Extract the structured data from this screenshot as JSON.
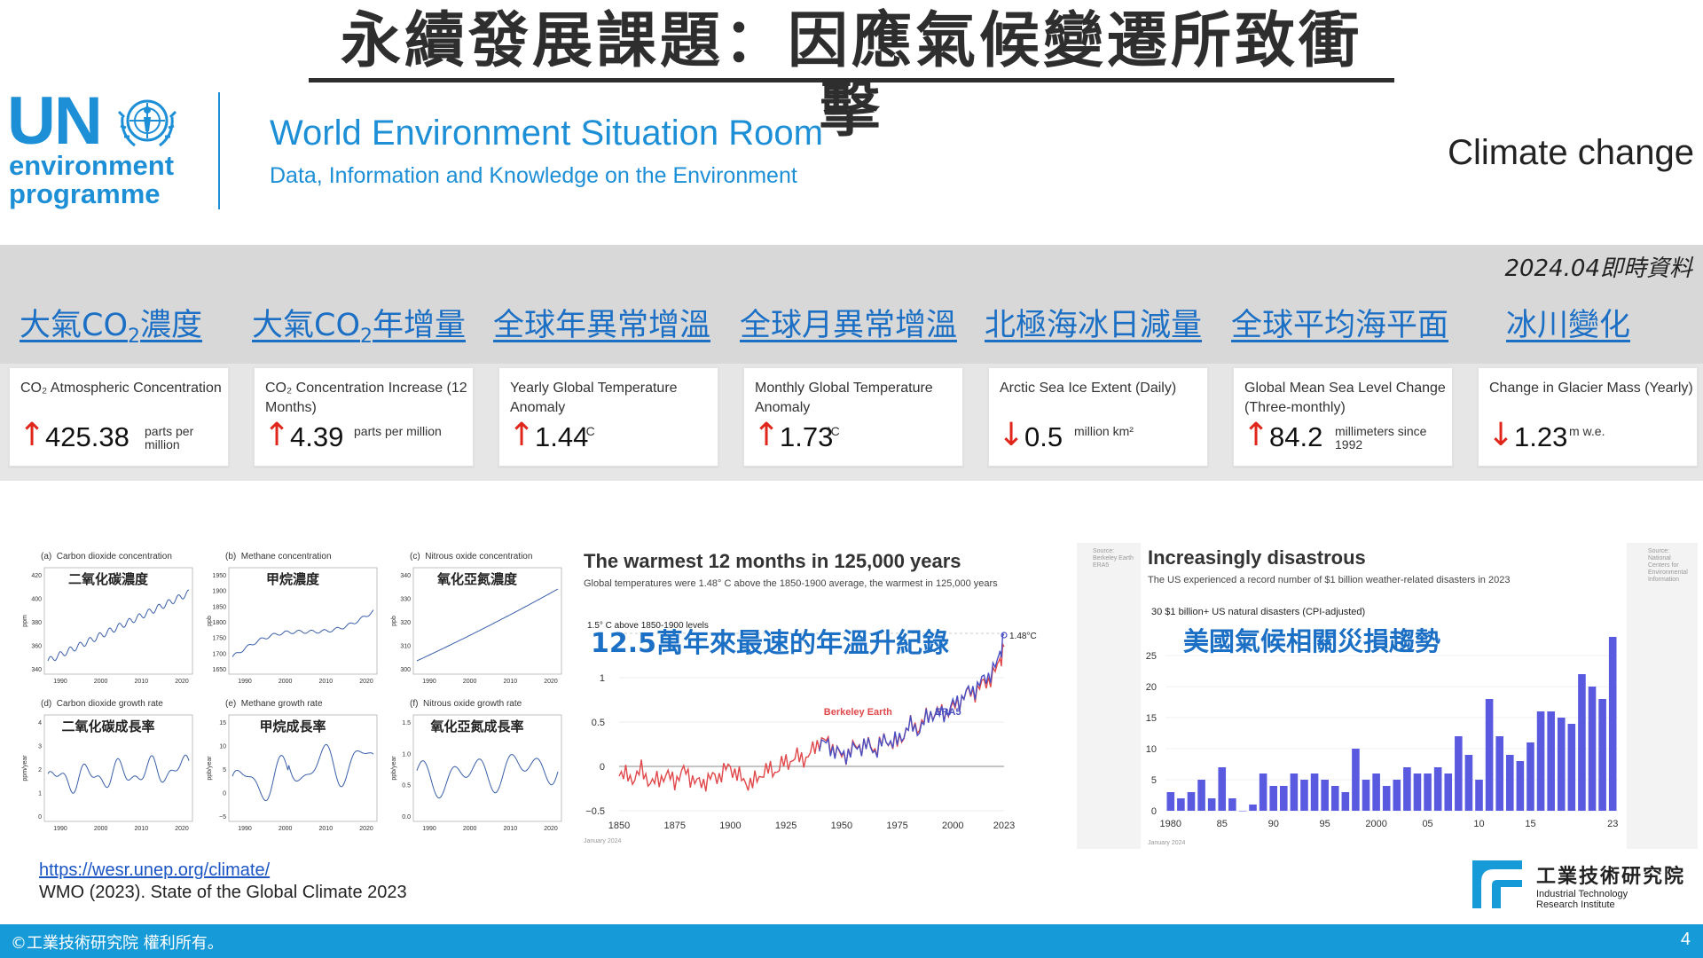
{
  "slide": {
    "title": "永續發展課題：因應氣候變遷所致衝擊",
    "page_number": "4",
    "footer": "©工業技術研究院 權利所有。",
    "realtime_note": "2024.04即時資料"
  },
  "unep": {
    "un": "UN",
    "line1": "environment",
    "line2": "programme",
    "title": "World Environment Situation Room",
    "subtitle": "Data, Information and Knowledge on the Environment",
    "topic": "Climate change"
  },
  "categories": [
    {
      "pre": "大氣CO",
      "sub": "2",
      "post": "濃度"
    },
    {
      "pre": "大氣CO",
      "sub": "2",
      "post": "年增量"
    },
    {
      "pre": "全球年異常增溫",
      "sub": "",
      "post": ""
    },
    {
      "pre": "全球月異常增溫",
      "sub": "",
      "post": ""
    },
    {
      "pre": "北極海冰日減量",
      "sub": "",
      "post": ""
    },
    {
      "pre": "全球平均海平面",
      "sub": "",
      "post": ""
    },
    {
      "pre": "冰川變化",
      "sub": "",
      "post": ""
    }
  ],
  "metrics": [
    {
      "name": "CO₂ Atmospheric Concentration",
      "arrow": "↑",
      "value": "425.38",
      "unit": "parts per million",
      "direction": "up"
    },
    {
      "name": "CO₂ Concentration Increase (12 Months)",
      "arrow": "↑",
      "value": "4.39",
      "unit": "parts per million",
      "direction": "up"
    },
    {
      "name": "Yearly Global Temperature Anomaly",
      "arrow": "↑",
      "value": "1.44",
      "unit": "°C",
      "direction": "up"
    },
    {
      "name": "Monthly Global Temperature Anomaly",
      "arrow": "↑",
      "value": "1.73",
      "unit": "°C",
      "direction": "up"
    },
    {
      "name": "Arctic Sea Ice Extent (Daily)",
      "arrow": "↓",
      "value": "0.5",
      "unit": "million km²",
      "direction": "down"
    },
    {
      "name": "Global Mean Sea Level Change (Three-monthly)",
      "arrow": "↑",
      "value": "84.2",
      "unit": "millimeters since 1992",
      "direction": "up"
    },
    {
      "name": "Change in Glacier Mass (Yearly)",
      "arrow": "↓",
      "value": "1.23",
      "unit": "m w.e.",
      "direction": "down"
    }
  ],
  "ghg_panels": [
    {
      "tag": "(a)",
      "title": "Carbon dioxide concentration",
      "zh": "二氧化碳濃度",
      "unit": "ppm",
      "yticks": [
        "420",
        "400",
        "380",
        "360",
        "340"
      ],
      "xticks": [
        "1990",
        "2000",
        "2010",
        "2020"
      ]
    },
    {
      "tag": "(b)",
      "title": "Methane concentration",
      "zh": "甲烷濃度",
      "unit": "ppb",
      "yticks": [
        "1950",
        "1900",
        "1850",
        "1800",
        "1750",
        "1700",
        "1650"
      ],
      "xticks": [
        "1990",
        "2000",
        "2010",
        "2020"
      ]
    },
    {
      "tag": "(c)",
      "title": "Nitrous oxide concentration",
      "zh": "氧化亞氮濃度",
      "unit": "ppb",
      "yticks": [
        "340",
        "330",
        "320",
        "310",
        "300"
      ],
      "xticks": [
        "1990",
        "2000",
        "2010",
        "2020"
      ]
    },
    {
      "tag": "(d)",
      "title": "Carbon dioxide growth rate",
      "zh": "二氧化碳成長率",
      "unit": "ppm/year",
      "yticks": [
        "4",
        "3",
        "2",
        "1",
        "0"
      ],
      "xticks": [
        "1990",
        "2000",
        "2010",
        "2020"
      ]
    },
    {
      "tag": "(e)",
      "title": "Methane growth rate",
      "zh": "甲烷成長率",
      "unit": "ppb/year",
      "yticks": [
        "15",
        "10",
        "5",
        "0",
        "−5"
      ],
      "xticks": [
        "1990",
        "2000",
        "2010",
        "2020"
      ]
    },
    {
      "tag": "(f)",
      "title": "Nitrous oxide growth rate",
      "zh": "氧化亞氮成長率",
      "unit": "ppb/year",
      "yticks": [
        "1.5",
        "1.0",
        "0.5",
        "0.0"
      ],
      "xticks": [
        "1990",
        "2000",
        "2010",
        "2020"
      ]
    }
  ],
  "chart_data": [
    {
      "type": "line",
      "title": "The warmest 12 months in 125,000 years",
      "subtitle": "Global temperatures were 1.48° C above the 1850-1900 average, the warmest in 125,000 years",
      "annotation_zh": "12.5萬年來最速的年溫升紀錄",
      "ylabel_note": "1.5° C above 1850-1900 levels",
      "end_label": "1.48°C",
      "source_note": "January 2024",
      "xticks": [
        "1850",
        "1875",
        "1900",
        "1925",
        "1950",
        "1975",
        "2000",
        "2023"
      ],
      "yticks": [
        "1",
        "0.5",
        "0",
        "−0.5"
      ],
      "ylim": [
        -0.5,
        1.6
      ],
      "xlim": [
        1850,
        2023
      ],
      "series": [
        {
          "name": "Berkeley Earth",
          "color": "#e0484b",
          "x": [
            1850,
            1855,
            1860,
            1865,
            1870,
            1875,
            1880,
            1885,
            1890,
            1895,
            1900,
            1905,
            1910,
            1915,
            1920,
            1925,
            1930,
            1935,
            1940,
            1945,
            1950,
            1955,
            1960,
            1965,
            1970,
            1975,
            1980,
            1985,
            1990,
            1995,
            2000,
            2005,
            2010,
            2015,
            2020,
            2023
          ],
          "values": [
            -0.05,
            -0.15,
            -0.05,
            -0.2,
            -0.1,
            -0.15,
            -0.05,
            -0.2,
            -0.15,
            -0.1,
            0.0,
            -0.15,
            -0.2,
            -0.05,
            -0.05,
            0.05,
            0.1,
            0.1,
            0.3,
            0.25,
            0.1,
            0.2,
            0.25,
            0.2,
            0.3,
            0.25,
            0.45,
            0.45,
            0.6,
            0.6,
            0.65,
            0.8,
            0.85,
            0.95,
            1.1,
            1.35
          ]
        },
        {
          "name": "ERA5",
          "color": "#4a4fc2",
          "x": [
            1940,
            1945,
            1950,
            1955,
            1960,
            1965,
            1970,
            1975,
            1980,
            1985,
            1990,
            1995,
            2000,
            2005,
            2010,
            2015,
            2020,
            2023
          ],
          "values": [
            0.28,
            0.22,
            0.12,
            0.18,
            0.25,
            0.18,
            0.3,
            0.27,
            0.45,
            0.42,
            0.6,
            0.58,
            0.68,
            0.8,
            0.88,
            1.0,
            1.15,
            1.48
          ]
        }
      ]
    },
    {
      "type": "bar",
      "title": "Increasingly disastrous",
      "subtitle": "The US experienced a record number of $1 billion weather-related disasters in 2023",
      "ylabel": "30 $1 billion+ US natural disasters (CPI-adjusted)",
      "annotation_zh": "美國氣候相關災損趨勢",
      "source_note": "January 2024",
      "color": "#5a5ae0",
      "xticks": [
        "1980",
        "85",
        "90",
        "95",
        "2000",
        "05",
        "10",
        "15",
        "23"
      ],
      "yticks": [
        "25",
        "20",
        "15",
        "10",
        "5",
        "0"
      ],
      "ylim": [
        0,
        30
      ],
      "categories": [
        "1980",
        "1981",
        "1982",
        "1983",
        "1984",
        "1985",
        "1986",
        "1987",
        "1988",
        "1989",
        "1990",
        "1991",
        "1992",
        "1993",
        "1994",
        "1995",
        "1996",
        "1997",
        "1998",
        "1999",
        "2000",
        "2001",
        "2002",
        "2003",
        "2004",
        "2005",
        "2006",
        "2007",
        "2008",
        "2009",
        "2010",
        "2011",
        "2012",
        "2013",
        "2014",
        "2015",
        "2016",
        "2017",
        "2018",
        "2019",
        "2020",
        "2021",
        "2022",
        "2023"
      ],
      "values": [
        3,
        2,
        3,
        5,
        2,
        7,
        2,
        0,
        1,
        6,
        4,
        4,
        6,
        5,
        6,
        5,
        4,
        3,
        10,
        5,
        6,
        4,
        5,
        7,
        6,
        6,
        7,
        6,
        12,
        9,
        5,
        18,
        12,
        9,
        8,
        11,
        16,
        16,
        15,
        14,
        22,
        20,
        18,
        28
      ]
    }
  ],
  "references": {
    "link": "https://wesr.unep.org/climate/",
    "citation": "WMO (2023). State of the Global Climate 2023"
  },
  "itri": {
    "zh": "工業技術研究院",
    "en1": "Industrial Technology",
    "en2": "Research Institute"
  },
  "colors": {
    "unep_blue": "#1d8fd6",
    "category_blue": "#1b6fc4",
    "arrow_red": "#e0251b",
    "footer_blue": "#169bd8"
  }
}
